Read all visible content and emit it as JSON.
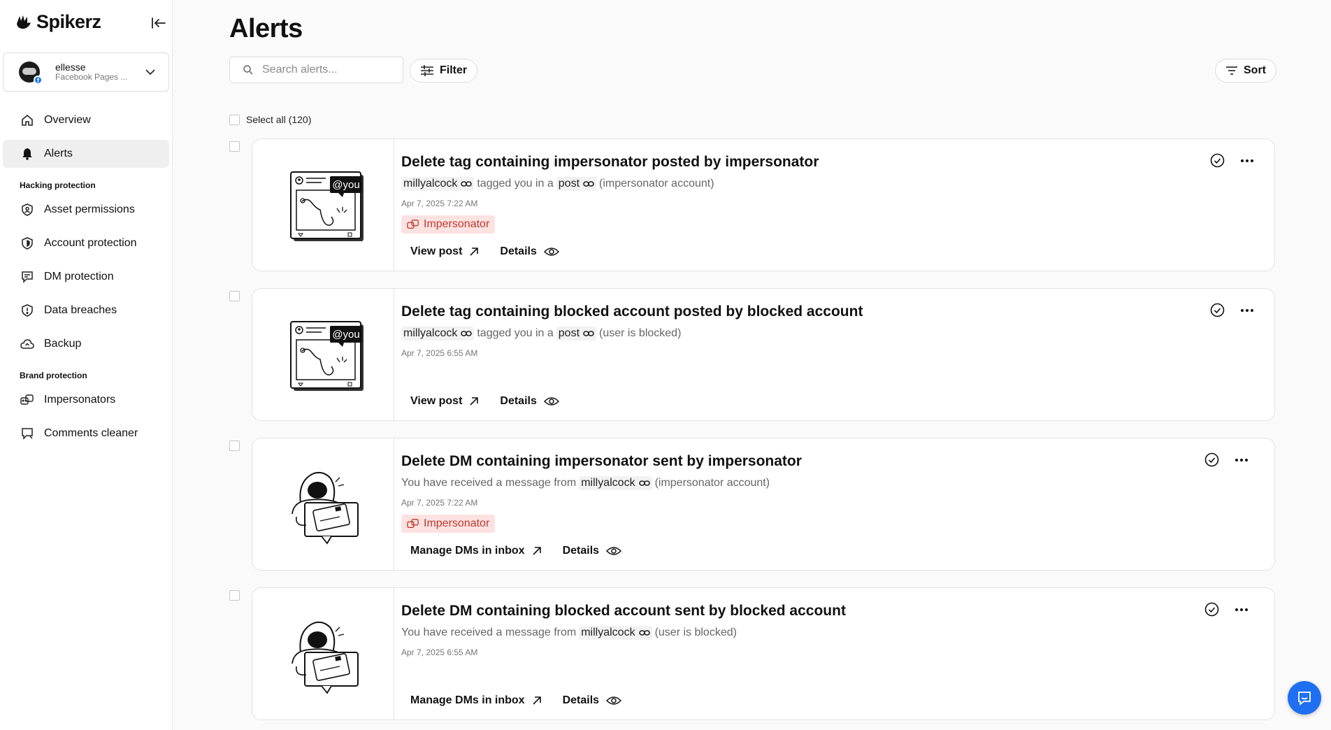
{
  "app": {
    "name": "Spikerz"
  },
  "account": {
    "name": "ellesse",
    "subtitle": "Facebook Pages ..."
  },
  "nav": {
    "overview": "Overview",
    "alerts": "Alerts",
    "section_hacking": "Hacking protection",
    "asset_permissions": "Asset permissions",
    "account_protection": "Account protection",
    "dm_protection": "DM protection",
    "data_breaches": "Data breaches",
    "backup": "Backup",
    "section_brand": "Brand protection",
    "impersonators": "Impersonators",
    "comments_cleaner": "Comments cleaner"
  },
  "page": {
    "title": "Alerts"
  },
  "search": {
    "placeholder": "Search alerts..."
  },
  "toolbar": {
    "filter_label": "Filter",
    "sort_label": "Sort",
    "select_all": "Select all (120)"
  },
  "alerts": [
    {
      "title": "Delete tag containing impersonator posted by impersonator",
      "user": "millyalcock",
      "mid": "tagged you in a",
      "object": "post",
      "suffix": "(impersonator account)",
      "date": "Apr 7, 2025 7:22 AM",
      "badge": "Impersonator",
      "action": "View post",
      "details": "Details",
      "bubble": "@you"
    },
    {
      "title": "Delete tag containing blocked account posted by blocked account",
      "user": "millyalcock",
      "mid": "tagged you in a",
      "object": "post",
      "suffix": "(user is blocked)",
      "date": "Apr 7, 2025 6:55 AM",
      "action": "View post",
      "details": "Details",
      "bubble": "@you"
    },
    {
      "title": "Delete DM containing impersonator sent by impersonator",
      "prefix": "You have received a message from",
      "user": "millyalcock",
      "suffix": "(impersonator account)",
      "date": "Apr 7, 2025 7:22 AM",
      "badge": "Impersonator",
      "action": "Manage DMs in inbox",
      "details": "Details"
    },
    {
      "title": "Delete DM containing blocked account sent by blocked account",
      "prefix": "You have received a message from",
      "user": "millyalcock",
      "suffix": "(user is blocked)",
      "date": "Apr 7, 2025 6:55 AM",
      "action": "Manage DMs in inbox",
      "details": "Details"
    }
  ]
}
